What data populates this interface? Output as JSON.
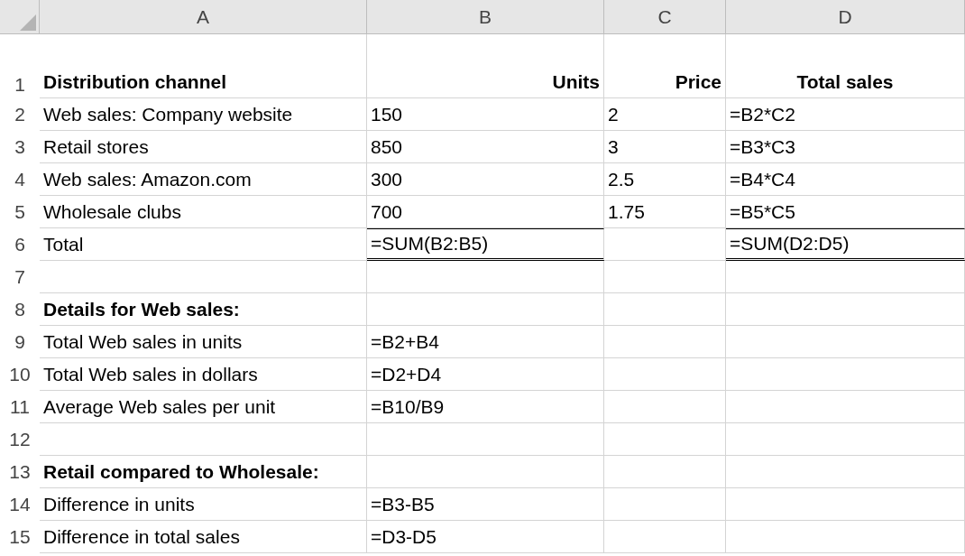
{
  "columns": [
    "A",
    "B",
    "C",
    "D"
  ],
  "rows": [
    {
      "number": "1",
      "cells": {
        "A": {
          "text": "Distribution channel",
          "bold": true
        },
        "B": {
          "text": "Units",
          "bold": true
        },
        "C": {
          "text": "Price",
          "bold": true
        },
        "D": {
          "text": "Total sales",
          "bold": true
        }
      }
    },
    {
      "number": "2",
      "cells": {
        "A": {
          "text": "Web sales: Company website"
        },
        "B": {
          "text": "150"
        },
        "C": {
          "text": "2"
        },
        "D": {
          "text": "=B2*C2"
        }
      }
    },
    {
      "number": "3",
      "cells": {
        "A": {
          "text": "Retail stores"
        },
        "B": {
          "text": "850"
        },
        "C": {
          "text": "3"
        },
        "D": {
          "text": "=B3*C3"
        }
      }
    },
    {
      "number": "4",
      "cells": {
        "A": {
          "text": "Web sales: Amazon.com"
        },
        "B": {
          "text": "300"
        },
        "C": {
          "text": "2.5"
        },
        "D": {
          "text": "=B4*C4"
        }
      }
    },
    {
      "number": "5",
      "cells": {
        "A": {
          "text": "Wholesale clubs"
        },
        "B": {
          "text": "700"
        },
        "C": {
          "text": "1.75"
        },
        "D": {
          "text": "=B5*C5"
        }
      }
    },
    {
      "number": "6",
      "cells": {
        "A": {
          "text": "Total"
        },
        "B": {
          "text": "=SUM(B2:B5)",
          "total_line": true
        },
        "D": {
          "text": "=SUM(D2:D5)",
          "total_line": true
        }
      }
    },
    {
      "number": "7",
      "cells": {}
    },
    {
      "number": "8",
      "cells": {
        "A": {
          "text": "Details for Web sales:",
          "bold": true
        }
      }
    },
    {
      "number": "9",
      "cells": {
        "A": {
          "text": "Total Web sales in units"
        },
        "B": {
          "text": "=B2+B4"
        }
      }
    },
    {
      "number": "10",
      "cells": {
        "A": {
          "text": "Total Web sales in dollars"
        },
        "B": {
          "text": "=D2+D4"
        }
      }
    },
    {
      "number": "11",
      "cells": {
        "A": {
          "text": "Average Web sales per unit"
        },
        "B": {
          "text": "=B10/B9"
        }
      }
    },
    {
      "number": "12",
      "cells": {}
    },
    {
      "number": "13",
      "cells": {
        "A": {
          "text": "Retail compared to Wholesale:",
          "bold": true
        }
      }
    },
    {
      "number": "14",
      "cells": {
        "A": {
          "text": "Difference in units"
        },
        "B": {
          "text": "=B3-B5"
        }
      }
    },
    {
      "number": "15",
      "cells": {
        "A": {
          "text": "Difference in total sales"
        },
        "B": {
          "text": "=D3-D5"
        }
      }
    }
  ]
}
